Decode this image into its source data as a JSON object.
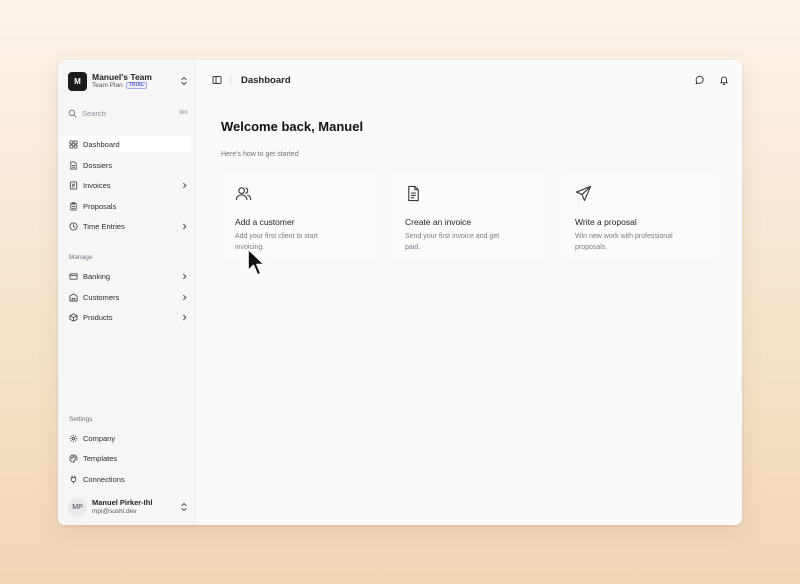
{
  "team": {
    "logo_letter": "M",
    "name": "Manuel's Team",
    "plan": "Team Plan",
    "badge": "TRIAL"
  },
  "search": {
    "label": "Search",
    "shortcut": "⌘K"
  },
  "nav": {
    "main": [
      {
        "label": "Dashboard",
        "icon": "dashboard-icon",
        "active": true
      },
      {
        "label": "Dossiers",
        "icon": "file-icon"
      },
      {
        "label": "Invoices",
        "icon": "invoice-icon",
        "chevron": true
      },
      {
        "label": "Proposals",
        "icon": "clipboard-icon"
      },
      {
        "label": "Time Entries",
        "icon": "clock-icon",
        "chevron": true
      }
    ],
    "manage_title": "Manage",
    "manage": [
      {
        "label": "Banking",
        "icon": "bank-icon",
        "chevron": true
      },
      {
        "label": "Customers",
        "icon": "building-icon",
        "chevron": true
      },
      {
        "label": "Products",
        "icon": "box-icon",
        "chevron": true
      }
    ],
    "settings_title": "Settings",
    "settings": [
      {
        "label": "Company",
        "icon": "gear-icon"
      },
      {
        "label": "Templates",
        "icon": "palette-icon"
      },
      {
        "label": "Connections",
        "icon": "plug-icon"
      }
    ]
  },
  "user": {
    "initials": "MP",
    "name": "Manuel Pirker-Ihl",
    "email": "mpi@sushi.dev"
  },
  "header": {
    "title": "Dashboard"
  },
  "main": {
    "welcome": "Welcome back, Manuel",
    "subtitle": "Here's how to get started",
    "cards": [
      {
        "icon": "users-icon",
        "title": "Add a customer",
        "desc_line1": "Add your first client to start",
        "desc_line2": "invoicing."
      },
      {
        "icon": "document-icon",
        "title": "Create an invoice",
        "desc_line1": "Send your first invoice and get",
        "desc_line2": "paid."
      },
      {
        "icon": "send-icon",
        "title": "Write a proposal",
        "desc_line1": "Win new work with professional",
        "desc_line2": "proposals."
      }
    ]
  },
  "colors": {
    "accent_badge": "#5b5fc7",
    "window_bg": "#f6f6f7",
    "main_bg": "#fafafa"
  }
}
